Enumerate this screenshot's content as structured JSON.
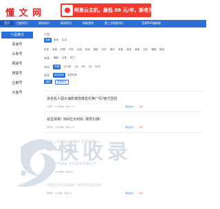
{
  "header": {
    "logo": "懂 文 网",
    "logo_sub": "DONGWENWANG.COM",
    "banner_text": "阿里云主机，最低 86 元/年，新老用户皆有优惠!"
  },
  "nav": {
    "items": [
      "首页",
      "百度知识",
      "搜狗知识",
      "新闻资讯",
      "网络营销",
      "第三方搜索排行",
      "音频PDF编辑器"
    ]
  },
  "sidebar": {
    "items": [
      "十品推文",
      "百家号",
      "头条号",
      "网易号",
      "搜狐号",
      "企鹅号",
      "大鱼号"
    ]
  },
  "filters": {
    "category_label": "分类",
    "category_tags": [
      "全部",
      "宝宝",
      "生活",
      "科技",
      "军事",
      "体育",
      "汽车",
      "社会",
      "时尚",
      "国际",
      "历史",
      "娱乐",
      "军事",
      "游戏",
      "美食",
      "文化",
      "健康",
      "财经"
    ],
    "source_label": "来源",
    "source_tags": [
      "最新",
      "分享",
      "热门"
    ],
    "time_label": "时间",
    "time_tags": [
      "不限",
      "12小时",
      "1天",
      "3天",
      "7天",
      "30天"
    ],
    "order_label": "排序",
    "order_tags": [
      "综合排序",
      "发布时间"
    ],
    "search_button": "搜索",
    "reset_button": "重置条件"
  },
  "list": [
    {
      "title": "多名名人因大海影楼改爆音乐换厂吗?官方回应",
      "meta": "百家号 · 10分钟前 · 阅读 2W",
      "read": "阅读全文",
      "share": "分享"
    },
    {
      "title": "谷宝深夜! 360亿大利好, 突然引爆!",
      "meta": "百家号 · 14分钟前 · 阅读 1W",
      "read": "阅读全文",
      "share": "分享"
    },
    {
      "title": "A股三大指数全线翻红 沪指涨超1%",
      "meta": "百家号 · 20分钟前 · 阅读 9K",
      "read": "阅读全文",
      "share": "分享"
    },
    {
      "title": "高温天气持续 多地发布预警信号",
      "meta": "百家号 · 32分钟前 · 阅读 8K",
      "read": "阅读全文",
      "share": "分享"
    },
    {
      "title": "中国空间站完成新一轮科学实验任务",
      "meta": "百家号 · 1小时前 · 阅读 5K",
      "read": "阅读全文",
      "share": "分享"
    }
  ],
  "watermark": "快收录"
}
